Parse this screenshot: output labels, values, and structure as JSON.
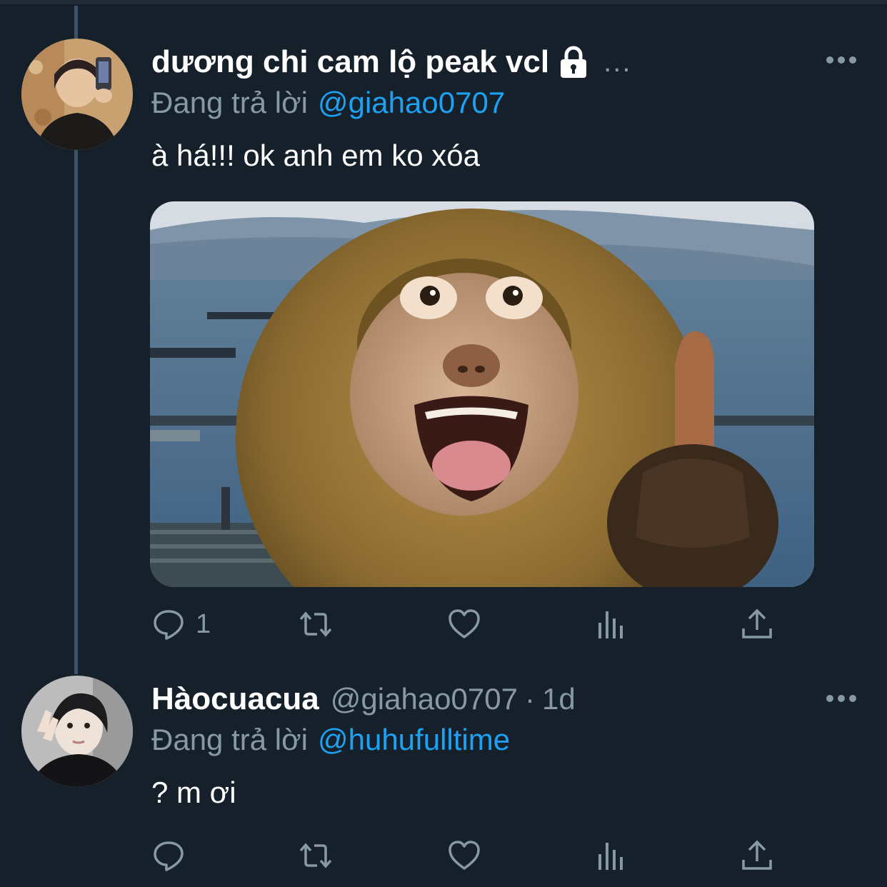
{
  "colors": {
    "background": "#15202b",
    "text_primary": "#ffffff",
    "text_secondary": "#8899a6",
    "accent": "#1da1f2",
    "thread_line": "#3d5466"
  },
  "tweets": [
    {
      "display_name": "dương chi cam lộ peak vcl",
      "truncation": "...",
      "protected_icon": "lock-icon",
      "replying_prefix": "Đang trả lời",
      "replying_to": "@giahao0707",
      "text": "à há!!! ok anh em ko xóa",
      "media_description_icon": "monkey-thumbs-up-photo",
      "actions": {
        "reply_count": "1",
        "retweet_count": "",
        "like_count": ""
      }
    },
    {
      "display_name": "Hàocuacua",
      "handle": "@giahao0707",
      "separator": "·",
      "time": "1d",
      "replying_prefix": "Đang trả lời",
      "replying_to": "@huhufulltime",
      "text": "? m ơi",
      "actions": {
        "reply_count": "",
        "retweet_count": "",
        "like_count": ""
      }
    }
  ]
}
